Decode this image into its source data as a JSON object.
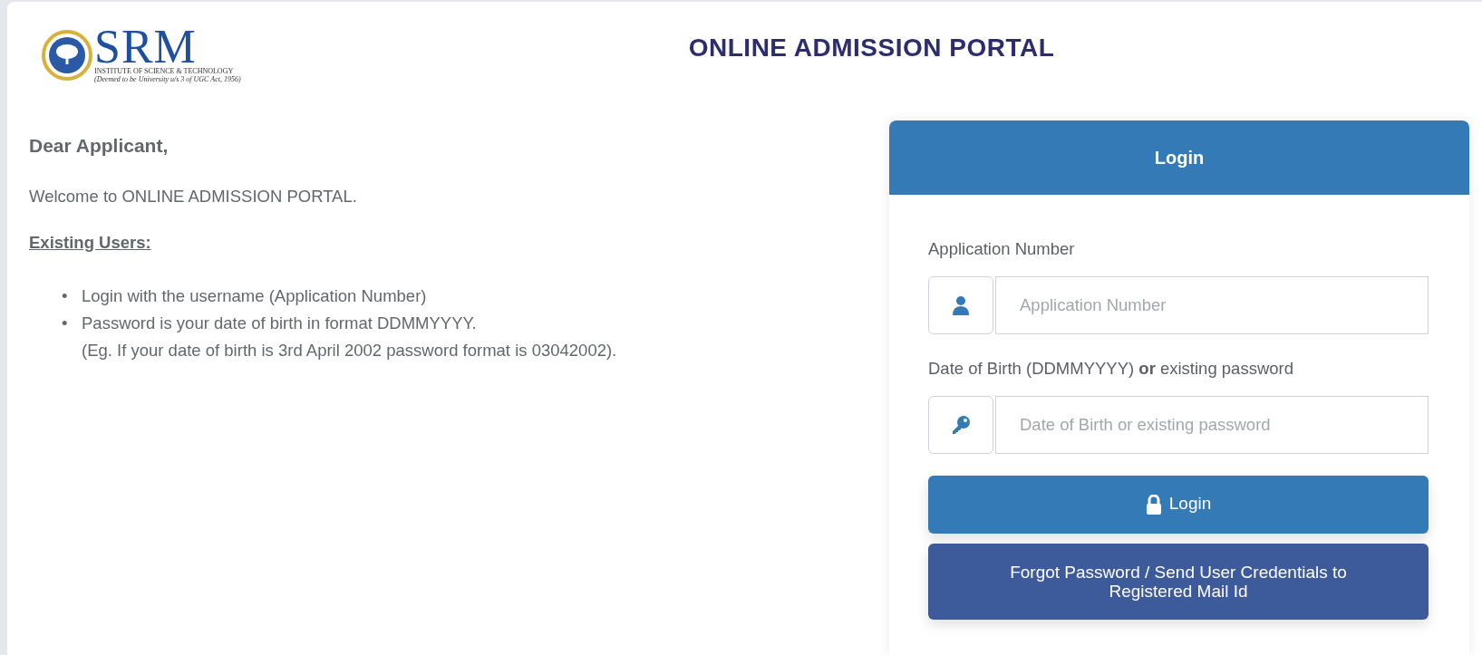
{
  "header": {
    "logo": {
      "wordmark": "SRM",
      "line_1": "INSTITUTE OF SCIENCE & TECHNOLOGY",
      "line_2": "(Deemed to be University u/s 3 of UGC Act, 1956)"
    },
    "title": "ONLINE ADMISSION PORTAL"
  },
  "intro": {
    "greeting": "Dear Applicant,",
    "welcome": "Welcome to ONLINE ADMISSION PORTAL.",
    "section_heading": "Existing Users:",
    "bullets": [
      {
        "marker": "•",
        "text": "Login with the username (Application Number)"
      },
      {
        "marker": "•",
        "text": "Password is your date of birth in format DDMMYYYY.",
        "note": "(Eg. If your date of birth is 3rd April 2002 password format is 03042002)."
      }
    ]
  },
  "login": {
    "title": "Login",
    "fields": [
      {
        "label": "Application Number",
        "placeholder": "Application Number"
      },
      {
        "label": "Date of Birth (DDMMYYYY) **or** existing password",
        "placeholder": "Date of Birth or existing password"
      }
    ],
    "buttons": [
      {
        "label": "Login",
        "kind": "primary"
      },
      {
        "label": "Forgot Password / Send User Credentials to Registered Mail Id",
        "kind": "secondary"
      }
    ]
  }
}
